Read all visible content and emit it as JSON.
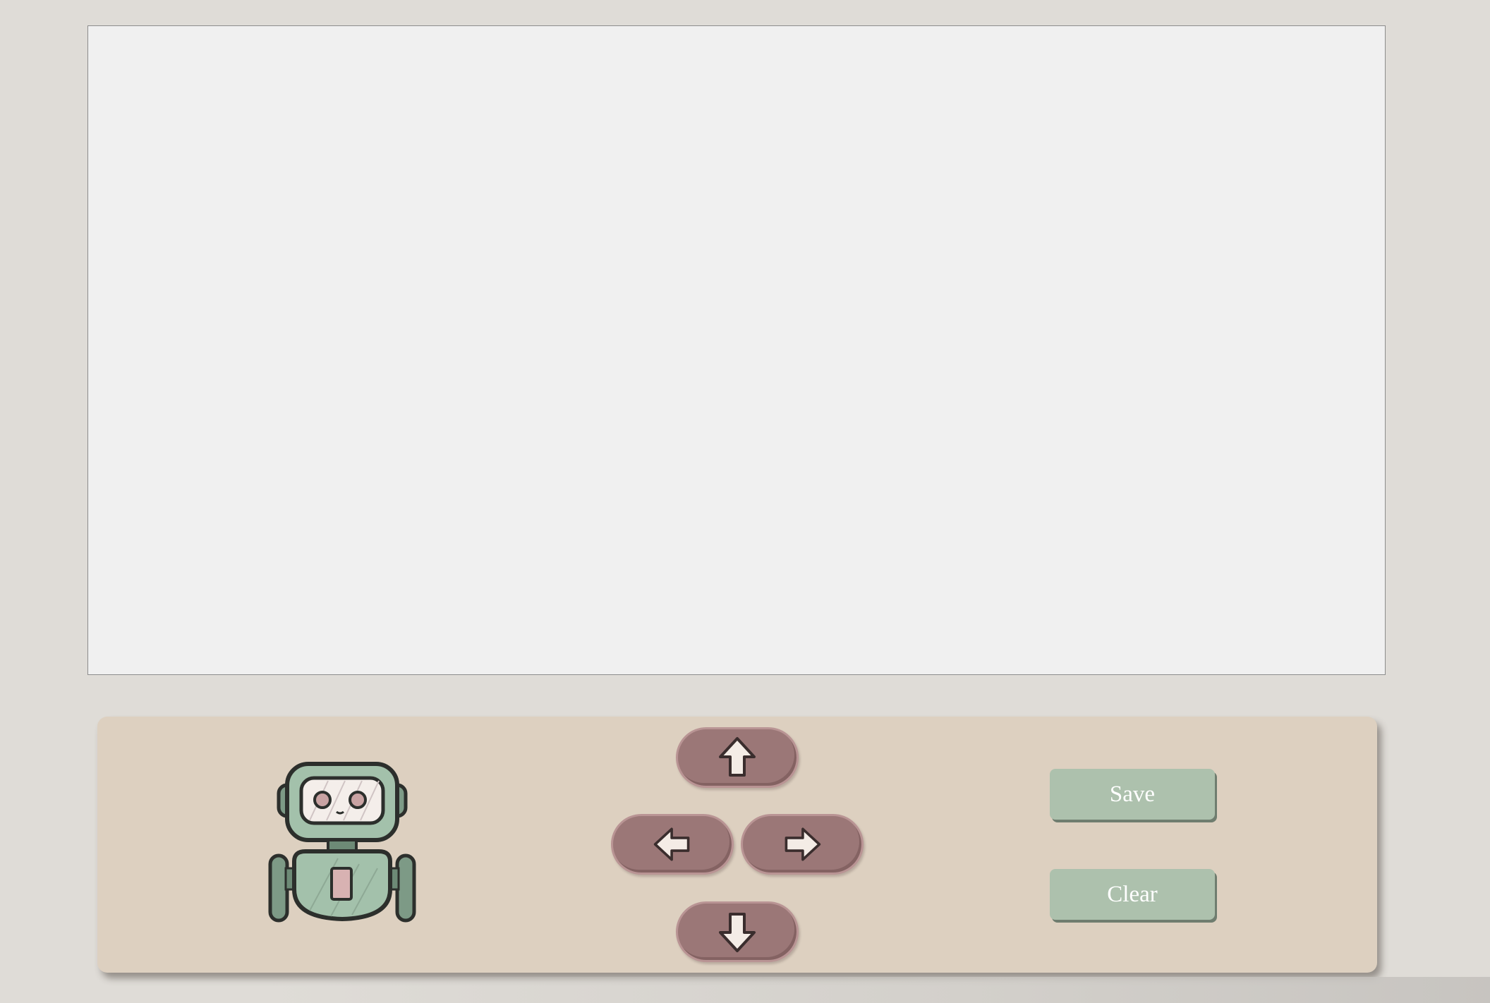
{
  "canvas": {
    "background": "#f0f0f0",
    "border_color": "#8c8c8c"
  },
  "control_panel": {
    "background": "#ddd0c0",
    "robot_icon": "robot-icon",
    "direction_buttons": {
      "up_icon": "arrow-up-icon",
      "left_icon": "arrow-left-icon",
      "right_icon": "arrow-right-icon",
      "down_icon": "arrow-down-icon",
      "color": "#9b7777"
    },
    "save_label": "Save",
    "clear_label": "Clear",
    "action_button_color": "#adc1ad"
  }
}
